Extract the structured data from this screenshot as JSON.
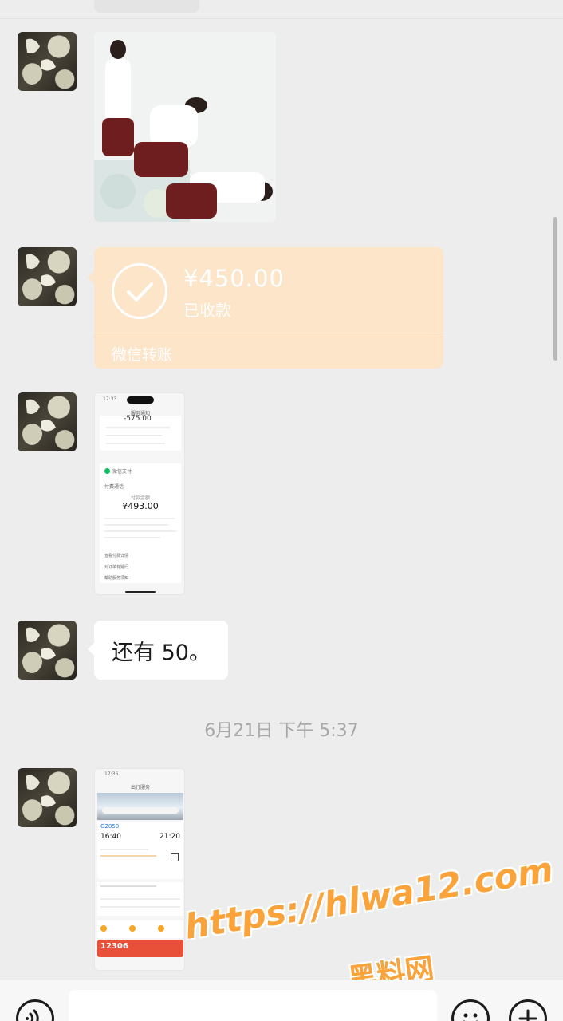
{
  "messages": {
    "transfer": {
      "amount": "¥450.00",
      "status": "已收款",
      "footer": "微信转账"
    },
    "payment_screenshot": {
      "status_time": "17:33",
      "header": "服务通知",
      "cropped_amount": "-575.00",
      "pay_label": "微信支付",
      "category": "付费通话",
      "amount": "¥493.00",
      "amount_caption": "付款金额",
      "links": [
        "查看付费详情",
        "对订单有疑问",
        "帮助服务须知"
      ]
    },
    "text": "还有 50。",
    "timestamp": "6月21日 下午 5:37",
    "ticket_screenshot": {
      "status_time": "17:36",
      "header": "出行服务",
      "train": "G2050",
      "depart_time": "16:40",
      "arrive_time": "21:20",
      "banner": "12306"
    }
  },
  "watermark": {
    "url": "https://hlwa12.com",
    "name": "黑料网"
  },
  "colors": {
    "background": "#ededed",
    "transfer_bubble": "#fde5c9",
    "watermark": "#f9a33a"
  },
  "icons": [
    "avatar",
    "check-circle-icon",
    "voice-icon",
    "emoji-icon",
    "plus-icon"
  ]
}
